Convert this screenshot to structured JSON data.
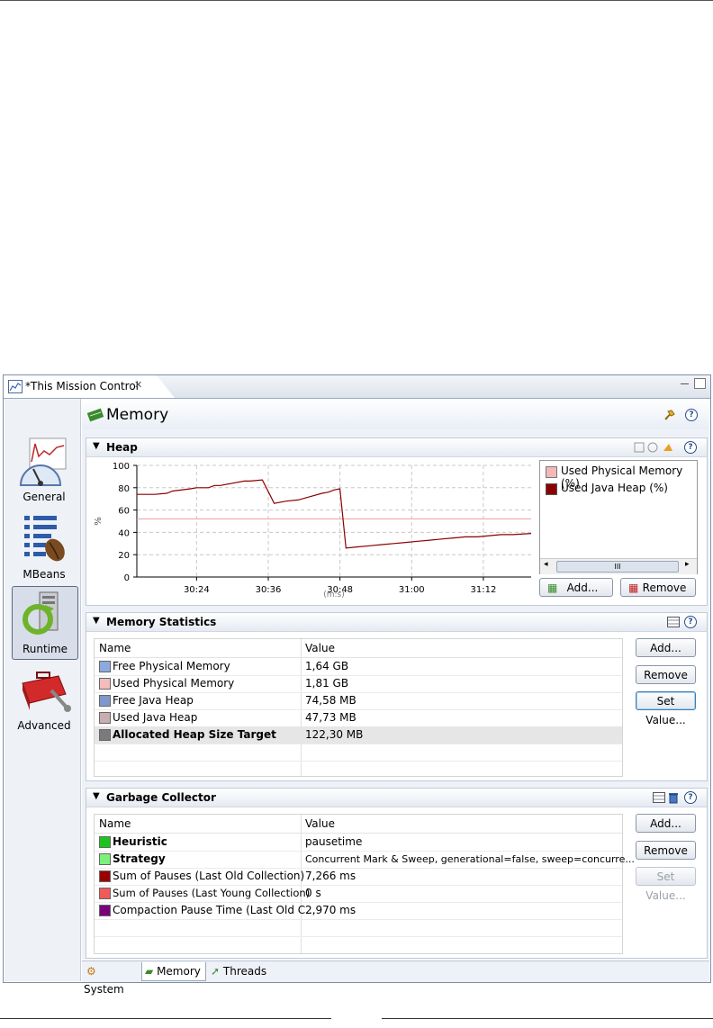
{
  "window": {
    "tab_title": "*This Mission Control"
  },
  "sidebar": {
    "items": [
      {
        "label": "General",
        "icon": "gauge-chart-icon"
      },
      {
        "label": "MBeans",
        "icon": "bean-list-icon"
      },
      {
        "label": "Runtime",
        "icon": "server-refresh-icon"
      },
      {
        "label": "Advanced",
        "icon": "toolbox-icon"
      }
    ],
    "selected": "Runtime"
  },
  "page": {
    "title": "Memory"
  },
  "heap": {
    "title": "Heap",
    "legend": [
      "Used Physical Memory (%)",
      "Used Java Heap (%)"
    ],
    "scroll_thumb": "III",
    "add_label": "Add...",
    "remove_label": "Remove"
  },
  "chart_data": {
    "type": "line",
    "ylabel": "%",
    "xlabel": "(m:s)",
    "ylim": [
      0,
      100
    ],
    "yticks": [
      "0",
      "20",
      "40",
      "60",
      "80",
      "100"
    ],
    "xticks": [
      "30:24",
      "30:36",
      "30:48",
      "31:00",
      "31:12"
    ],
    "series": [
      {
        "name": "Used Physical Memory (%)",
        "color": "#f0a0a0",
        "x": [
          "30:14",
          "31:20"
        ],
        "values": [
          52,
          52
        ]
      },
      {
        "name": "Used Java Heap (%)",
        "color": "#8b0000",
        "x": [
          "30:14",
          "30:16",
          "30:17",
          "30:19",
          "30:20",
          "30:23",
          "30:24",
          "30:26",
          "30:27",
          "30:28",
          "30:30",
          "30:32",
          "30:33",
          "30:35",
          "30:37",
          "30:39",
          "30:41",
          "30:43",
          "30:45",
          "30:46",
          "30:47",
          "30:48",
          "30:49",
          "30:51",
          "30:53",
          "30:55",
          "30:57",
          "30:59",
          "31:01",
          "31:03",
          "31:05",
          "31:07",
          "31:09",
          "31:11",
          "31:13",
          "31:15",
          "31:17",
          "31:20"
        ],
        "values": [
          74,
          74,
          74,
          75,
          77,
          79,
          80,
          80,
          82,
          82,
          84,
          86,
          86,
          87,
          66,
          68,
          69,
          72,
          75,
          76,
          78,
          79,
          26,
          27,
          28,
          29,
          30,
          31,
          32,
          33,
          34,
          35,
          36,
          36,
          37,
          38,
          38,
          39
        ]
      }
    ]
  },
  "memory_statistics": {
    "title": "Memory Statistics",
    "columns": [
      "Name",
      "Value"
    ],
    "rows": [
      {
        "name": "Free Physical Memory",
        "value": "1,64 GB",
        "color": "#8ea9e0"
      },
      {
        "name": "Used Physical Memory",
        "value": "1,81 GB",
        "color": "#f5bcbc"
      },
      {
        "name": "Free Java Heap",
        "value": "74,58 MB",
        "color": "#7e97cc"
      },
      {
        "name": "Used Java Heap",
        "value": "47,73 MB",
        "color": "#c8aeb0"
      },
      {
        "name": "Allocated Heap Size Target",
        "value": "122,30 MB",
        "color": "#7a7a7a"
      }
    ],
    "add_label": "Add...",
    "remove_label": "Remove",
    "set_value_label": "Set Value..."
  },
  "garbage_collector": {
    "title": "Garbage Collector",
    "columns": [
      "Name",
      "Value"
    ],
    "rows": [
      {
        "name": "Heuristic",
        "value": "pausetime",
        "color": "#1ec41e"
      },
      {
        "name": "Strategy",
        "value": "Concurrent Mark & Sweep, generational=false, sweep=concurre...",
        "color": "#7cf07c"
      },
      {
        "name": "Sum of Pauses (Last Old Collection)",
        "value": "7,266 ms",
        "color": "#9b0000"
      },
      {
        "name": "Sum of Pauses (Last Young Collection)",
        "value": "0 s",
        "color": "#f25a5a"
      },
      {
        "name": "Compaction Pause Time (Last Old C...",
        "value": "2,970 ms",
        "color": "#7a007a"
      }
    ],
    "add_label": "Add...",
    "remove_label": "Remove",
    "set_value_label": "Set Value..."
  },
  "bottom_tabs": [
    {
      "label": "System",
      "icon": "gears-icon"
    },
    {
      "label": "Memory",
      "icon": "memory-chip-icon"
    },
    {
      "label": "Threads",
      "icon": "threads-icon"
    }
  ]
}
